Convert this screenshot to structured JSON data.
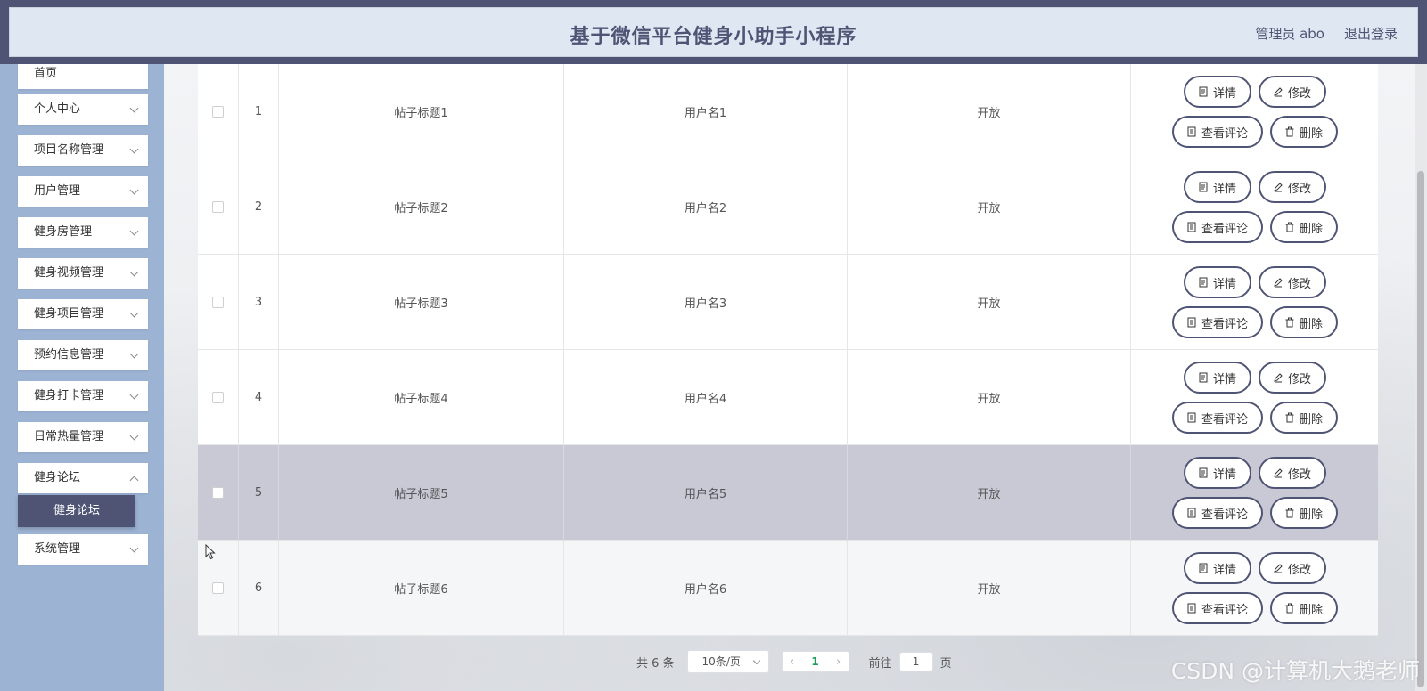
{
  "header": {
    "title": "基于微信平台健身小助手小程序",
    "admin": "管理员 abo",
    "logout": "退出登录"
  },
  "sidebar": {
    "items": [
      {
        "label": "首页"
      },
      {
        "label": "个人中心"
      },
      {
        "label": "项目名称管理"
      },
      {
        "label": "用户管理"
      },
      {
        "label": "健身房管理"
      },
      {
        "label": "健身视频管理"
      },
      {
        "label": "健身项目管理"
      },
      {
        "label": "预约信息管理"
      },
      {
        "label": "健身打卡管理"
      },
      {
        "label": "日常热量管理"
      },
      {
        "label": "健身论坛"
      },
      {
        "label": "系统管理"
      }
    ],
    "submenu": {
      "label": "健身论坛"
    }
  },
  "table": {
    "rows": [
      {
        "index": "1",
        "title": "帖子标题1",
        "user": "用户名1",
        "status": "开放"
      },
      {
        "index": "2",
        "title": "帖子标题2",
        "user": "用户名2",
        "status": "开放"
      },
      {
        "index": "3",
        "title": "帖子标题3",
        "user": "用户名3",
        "status": "开放"
      },
      {
        "index": "4",
        "title": "帖子标题4",
        "user": "用户名4",
        "status": "开放"
      },
      {
        "index": "5",
        "title": "帖子标题5",
        "user": "用户名5",
        "status": "开放"
      },
      {
        "index": "6",
        "title": "帖子标题6",
        "user": "用户名6",
        "status": "开放"
      }
    ],
    "actions": {
      "detail": "详情",
      "edit": "修改",
      "comments": "查看评论",
      "delete": "删除"
    }
  },
  "pagination": {
    "total": "共 6 条",
    "page_size": "10条/页",
    "current_page": "1",
    "goto_label": "前往",
    "goto_value": "1",
    "page_suffix": "页"
  },
  "watermark": "CSDN @计算机大鹅老师",
  "colors": {
    "primary": "#4f5475",
    "sidebar_bg": "#9db3d3",
    "header_bg": "#dfe8f2",
    "hover_row": "#c8c9d5",
    "page_active": "#18a058"
  }
}
